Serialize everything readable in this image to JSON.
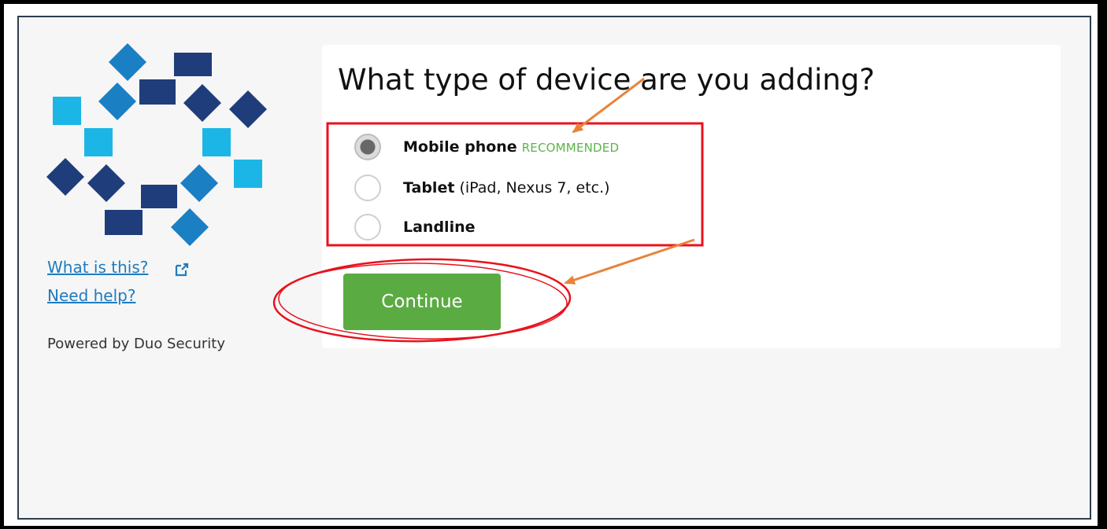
{
  "sidebar": {
    "what_is_this": "What is this?",
    "need_help": "Need help?",
    "powered_by": "Powered by Duo Security"
  },
  "main": {
    "title": "What type of device are you adding?",
    "options": [
      {
        "label": "Mobile phone",
        "extra": "",
        "badge": "RECOMMENDED",
        "selected": true
      },
      {
        "label": "Tablet",
        "extra": " (iPad, Nexus 7, etc.)",
        "badge": "",
        "selected": false
      },
      {
        "label": "Landline",
        "extra": "",
        "badge": "",
        "selected": false
      }
    ],
    "continue_label": "Continue"
  },
  "icons": {
    "logo": "duo-logo-icon",
    "external": "external-link-icon",
    "radio": "radio-button-icon"
  },
  "colors": {
    "link": "#1f7bc0",
    "continue": "#5bab43",
    "recommended": "#5db34a",
    "logo_light": "#1bb6e6",
    "logo_mid": "#1b7fc4",
    "logo_dark": "#1f3d7a",
    "annotation_red": "#e8121d",
    "annotation_arrow": "#e8843a"
  }
}
